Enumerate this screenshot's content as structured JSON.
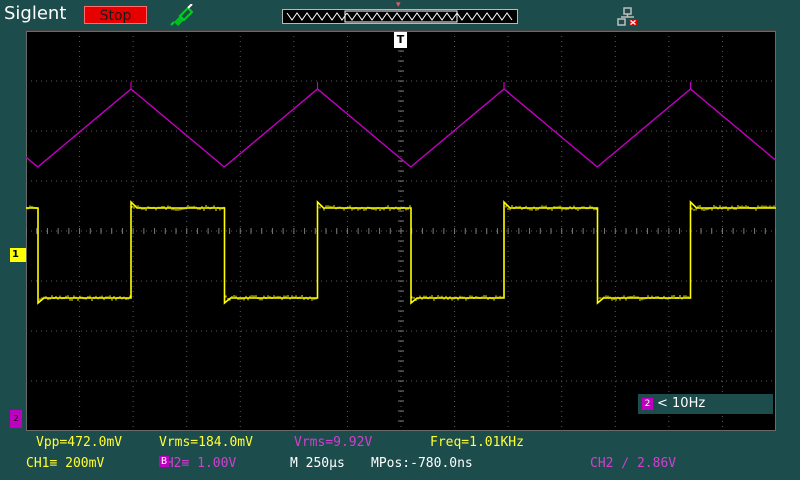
{
  "header": {
    "brand": "Siglent",
    "run_state": "Stop",
    "probe_icon": "probe-icon",
    "network_icon": "network-disconnected-icon"
  },
  "display": {
    "trigger_position_label": "T",
    "ch1_marker": "1",
    "ch2_marker": "2",
    "ch1_color": "#ffff00",
    "ch2_color": "#c000c0"
  },
  "trigger_info": {
    "source_badge": "2",
    "text": "< 10Hz"
  },
  "measurements": {
    "vpp": "Vpp=472.0mV",
    "vrms_ch1": "Vrms=184.0mV",
    "vrms_ch2": "Vrms=9.92V",
    "freq": "Freq=1.01KHz"
  },
  "settings": {
    "ch1": "CH1≡ 200mV",
    "ch2": "CH2≡ 1.00V",
    "ch2_bw_badge": "B",
    "timebase": "M 250µs",
    "mpos": "MPos:-780.0ns",
    "trigger": "CH2 ∕ 2.86V"
  }
}
